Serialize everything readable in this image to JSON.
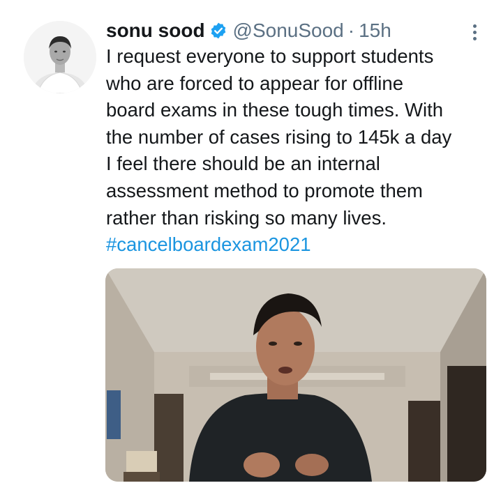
{
  "tweet": {
    "author_name": "sonu sood",
    "handle": "@SonuSood",
    "separator": "·",
    "time": "15h",
    "lines": [
      "I request everyone to support students",
      "who are forced to appear for offline",
      "board exams in these tough times. With",
      "the number of cases rising to 145k a day",
      "I feel there should be an internal",
      "assessment method to promote them",
      "rather than risking so many lives."
    ],
    "hashtag": "#cancelboardexam2021"
  },
  "icons": {
    "verified": "verified-badge-icon",
    "more": "more-options-icon"
  },
  "colors": {
    "text": "#14171a",
    "secondary": "#5b7083",
    "link": "#1b95e0",
    "verified": "#1da1f2"
  }
}
